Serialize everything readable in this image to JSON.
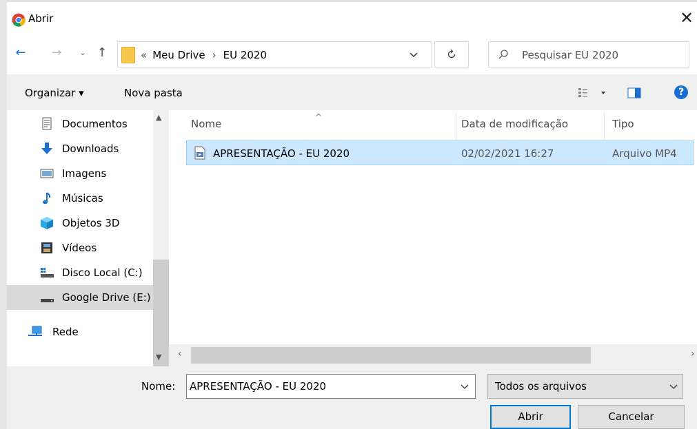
{
  "window": {
    "title": "Abrir"
  },
  "nav": {
    "address_parts": [
      "«",
      "Meu Drive",
      "›",
      "EU 2020"
    ],
    "search_placeholder": "Pesquisar EU 2020"
  },
  "toolbar": {
    "organize_label": "Organizar ▾",
    "new_folder_label": "Nova pasta"
  },
  "sidebar": {
    "items": [
      {
        "label": "Documentos",
        "icon": "document-icon"
      },
      {
        "label": "Downloads",
        "icon": "download-arrow-icon"
      },
      {
        "label": "Imagens",
        "icon": "pictures-icon"
      },
      {
        "label": "Músicas",
        "icon": "music-note-icon"
      },
      {
        "label": "Objetos 3D",
        "icon": "cube-icon"
      },
      {
        "label": "Vídeos",
        "icon": "film-icon"
      },
      {
        "label": "Disco Local (C:)",
        "icon": "local-disk-icon"
      },
      {
        "label": "Google Drive (E:)",
        "icon": "drive-icon"
      },
      {
        "label": "Rede",
        "icon": "network-icon"
      }
    ]
  },
  "table": {
    "columns": [
      "Nome",
      "Data de modificação",
      "Tipo"
    ],
    "rows": [
      {
        "name": "APRESENTAÇÃO - EU 2020",
        "date": "02/02/2021 16:27",
        "type": "Arquivo MP4"
      }
    ]
  },
  "footer": {
    "name_label": "Nome:",
    "name_value": "APRESENTAÇÃO - EU 2020",
    "filter_value": "Todos os arquivos",
    "open_label": "Abrir",
    "cancel_label": "Cancelar"
  },
  "colors": {
    "selection": "#cce8ff",
    "accent": "#0078d7",
    "help": "#1a6fd1"
  }
}
